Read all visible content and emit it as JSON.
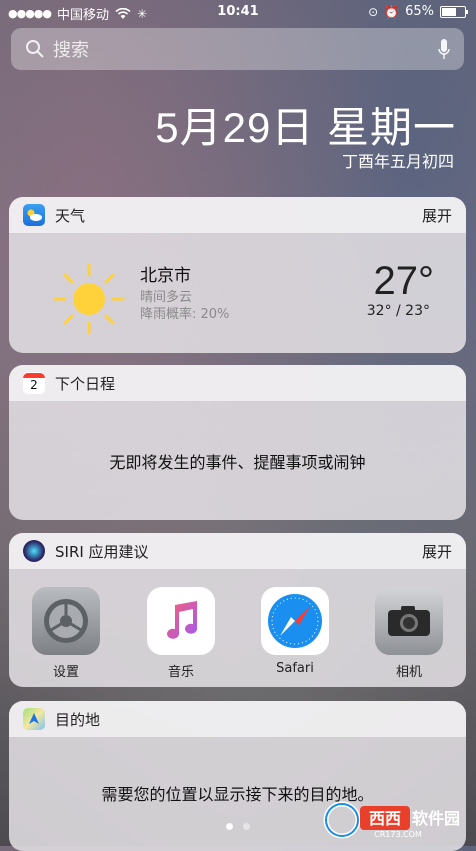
{
  "status_bar": {
    "carrier": "中国移动",
    "time": "10:41",
    "battery": "65%",
    "battery_level": 0.65
  },
  "search": {
    "placeholder": "搜索"
  },
  "date": {
    "main": "5月29日 星期一",
    "lunar": "丁酉年五月初四"
  },
  "weather_widget": {
    "title": "天气",
    "expand_label": "展开",
    "city": "北京市",
    "condition": "晴间多云",
    "rain_chance": "降雨概率: 20%",
    "temperature": "27°",
    "high_low": "32° / 23°"
  },
  "calendar_widget": {
    "title": "下个日程",
    "icon_day": "2",
    "message": "无即将发生的事件、提醒事项或闹钟"
  },
  "siri_widget": {
    "title": "SIRI 应用建议",
    "expand_label": "展开",
    "apps": [
      {
        "label": "设置",
        "icon": "settings-icon"
      },
      {
        "label": "音乐",
        "icon": "music-icon"
      },
      {
        "label": "Safari",
        "icon": "safari-icon"
      },
      {
        "label": "相机",
        "icon": "camera-icon"
      }
    ]
  },
  "destination_widget": {
    "title": "目的地",
    "message": "需要您的位置以显示接下来的目的地。"
  },
  "page_dots": {
    "count": 2,
    "active": 0
  },
  "watermark": {
    "text": "西西软件园",
    "sub": "CR173.COM"
  }
}
